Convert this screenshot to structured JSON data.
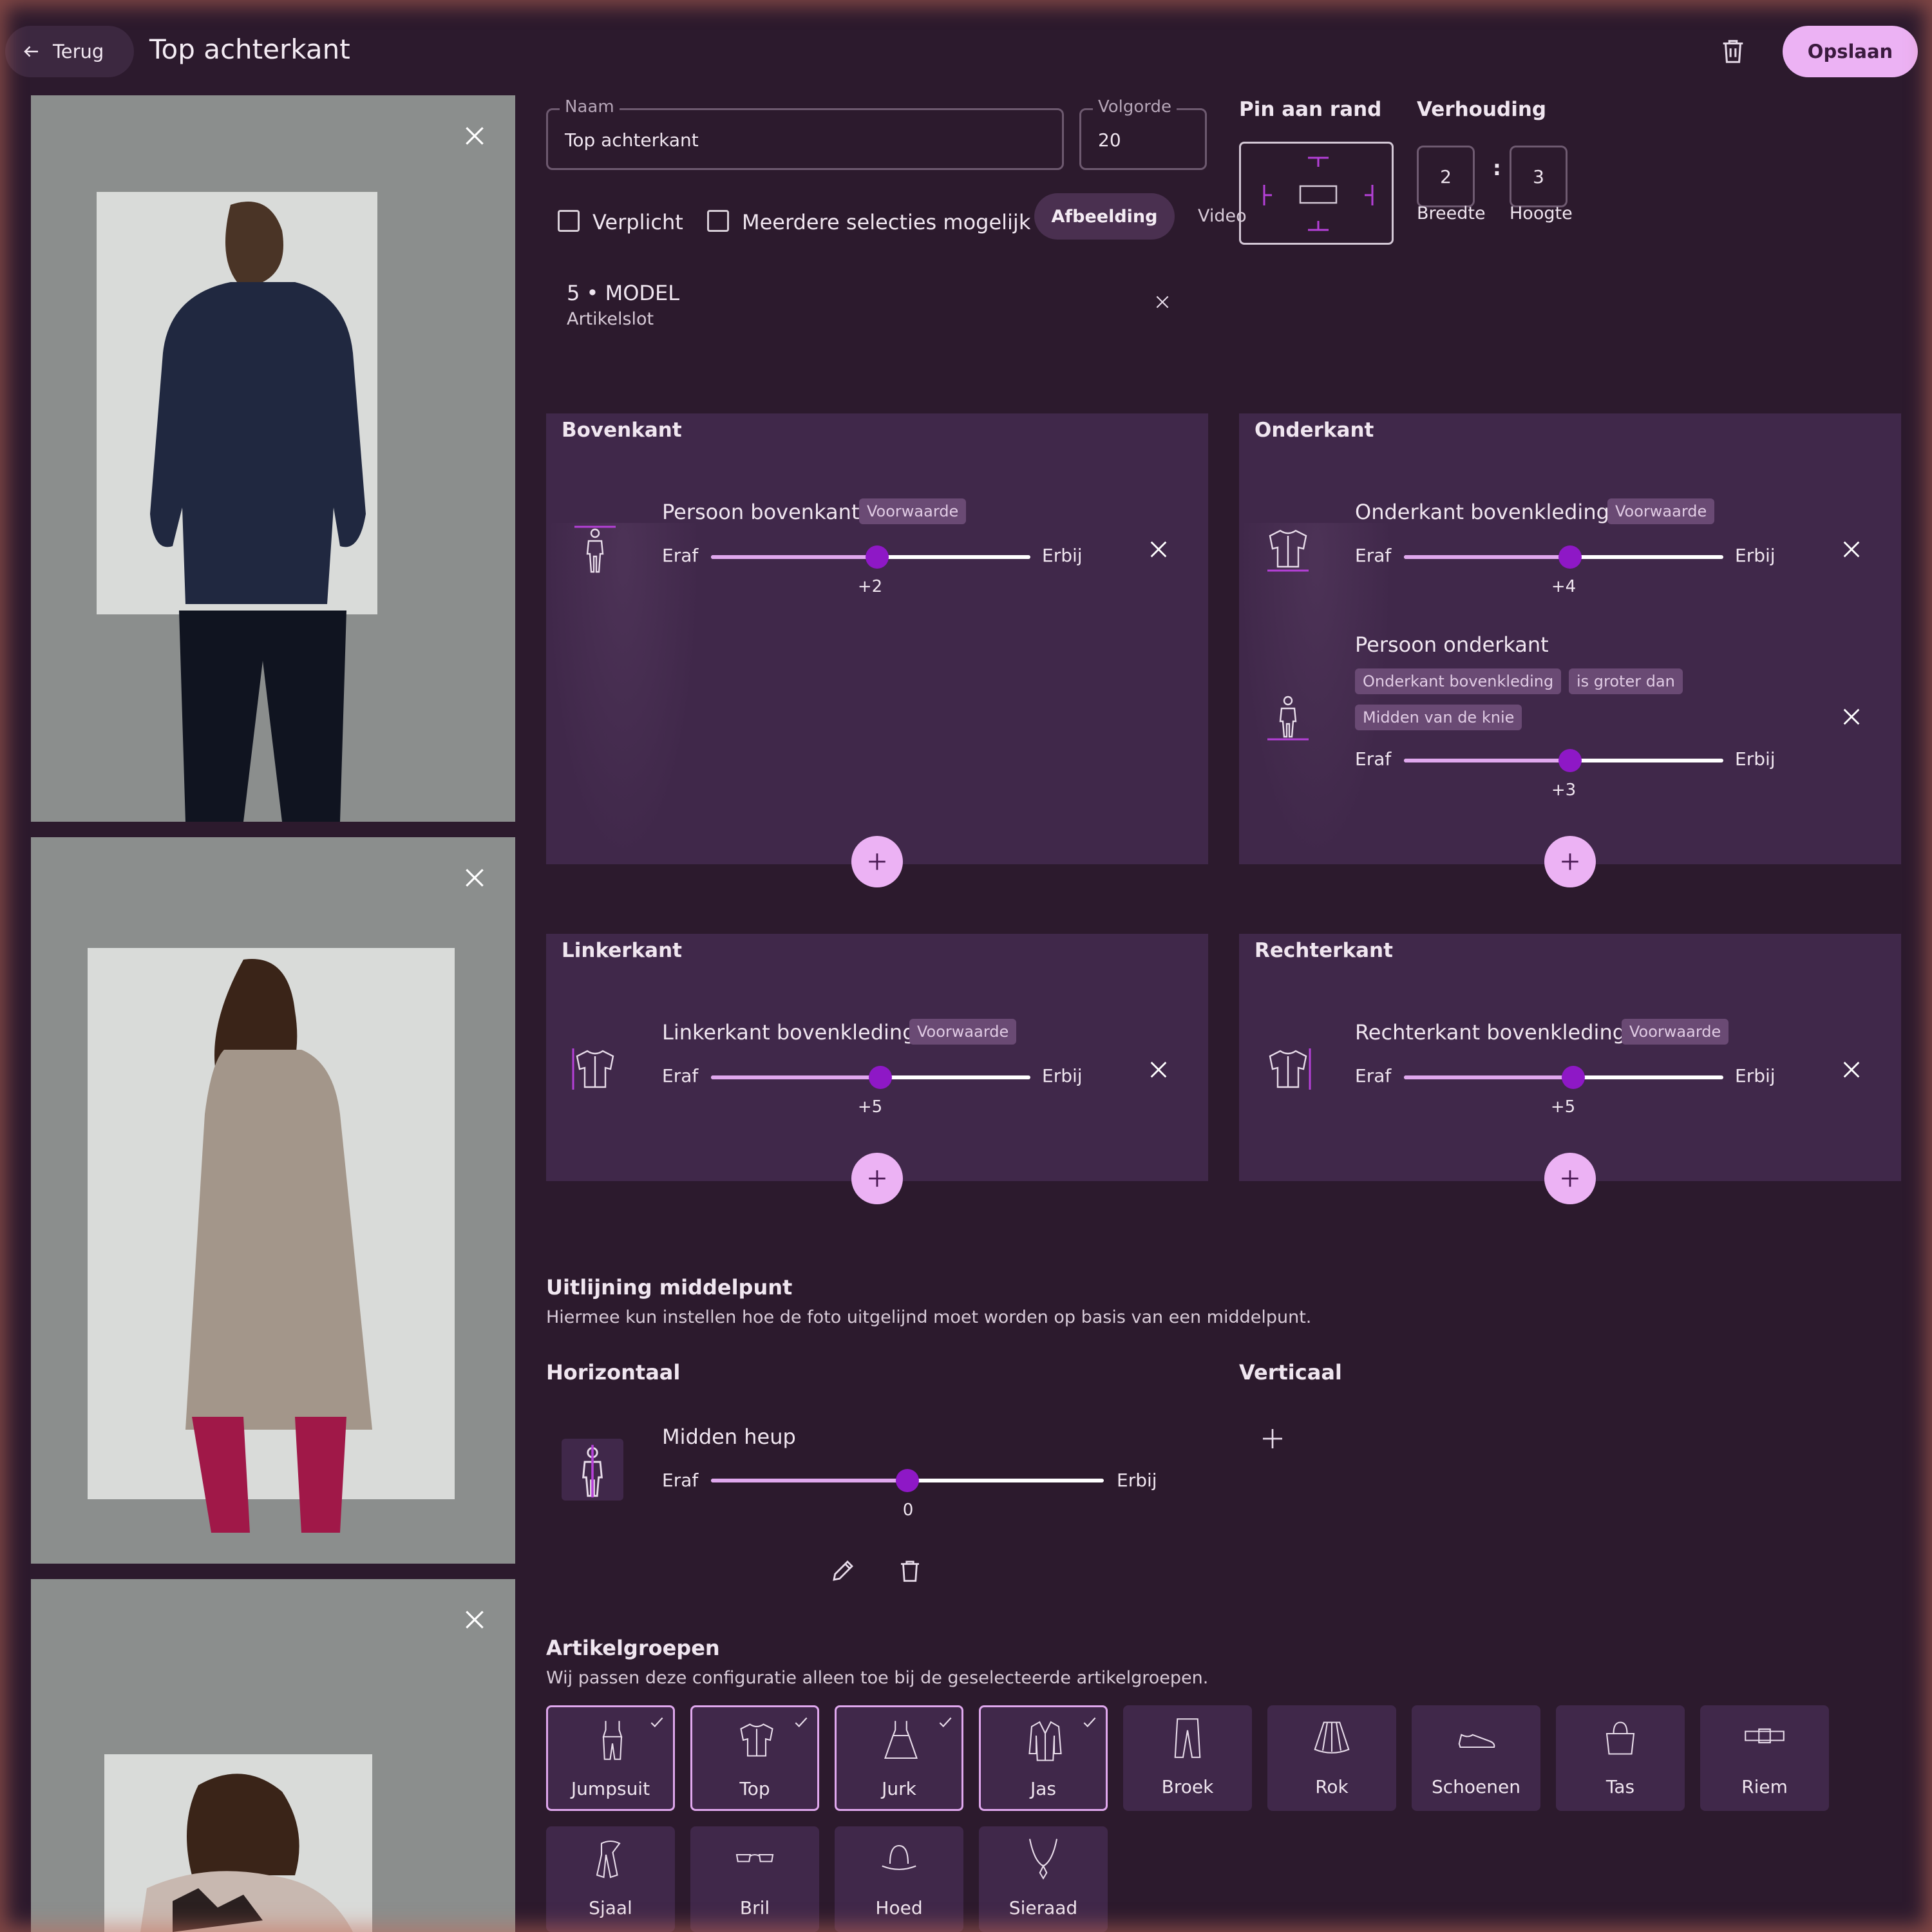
{
  "header": {
    "back_label": "Terug",
    "title": "Top achterkant",
    "save_label": "Opslaan"
  },
  "form": {
    "name_label": "Naam",
    "name_value": "Top achterkant",
    "order_label": "Volgorde",
    "order_value": "20",
    "pin_label": "Pin aan rand",
    "ratio_label": "Verhouding",
    "ratio_width": "2",
    "ratio_height": "3",
    "ratio_sep": ":",
    "ratio_width_label": "Breedte",
    "ratio_height_label": "Hoogte",
    "required_label": "Verplicht",
    "multi_label": "Meerdere selecties mogelijk",
    "tab_image": "Afbeelding",
    "tab_video": "Video",
    "slot_title": "5 • MODEL",
    "slot_sub": "Artikelslot"
  },
  "panels": {
    "top": {
      "title": "Bovenkant",
      "rules": [
        {
          "name": "Persoon bovenkant",
          "badge": "Voorwaarde",
          "left": "Eraf",
          "right": "Erbij",
          "value": "+2",
          "pos": 0.52
        }
      ]
    },
    "bottom": {
      "title": "Onderkant",
      "rules": [
        {
          "name": "Onderkant bovenkleding",
          "badge": "Voorwaarde",
          "left": "Eraf",
          "right": "Erbij",
          "value": "+4",
          "pos": 0.52
        },
        {
          "name": "Persoon onderkant",
          "badge1": "Onderkant bovenkleding",
          "badge2": "is groter dan",
          "badge3": "Midden van de knie",
          "left": "Eraf",
          "right": "Erbij",
          "value": "+3",
          "pos": 0.52
        }
      ]
    },
    "left": {
      "title": "Linkerkant",
      "rules": [
        {
          "name": "Linkerkant bovenkleding",
          "badge": "Voorwaarde",
          "left": "Eraf",
          "right": "Erbij",
          "value": "+5",
          "pos": 0.53
        }
      ]
    },
    "right": {
      "title": "Rechterkant",
      "rules": [
        {
          "name": "Rechterkant bovenkleding",
          "badge": "Voorwaarde",
          "left": "Eraf",
          "right": "Erbij",
          "value": "+5",
          "pos": 0.53
        }
      ]
    }
  },
  "alignment": {
    "title": "Uitlijning middelpunt",
    "description": "Hiermee kun instellen hoe de foto uitgelijnd moet worden op basis van een middelpunt.",
    "horizontal_label": "Horizontaal",
    "vertical_label": "Verticaal",
    "rule_name": "Midden heup",
    "left": "Eraf",
    "right": "Erbij",
    "value": "0",
    "pos": 0.5
  },
  "categories": {
    "title": "Artikelgroepen",
    "description": "Wij passen deze configuratie alleen toe bij de geselecteerde artikelgroepen.",
    "items": [
      {
        "label": "Jumpsuit",
        "icon": "jumpsuit-icon",
        "selected": true
      },
      {
        "label": "Top",
        "icon": "shirt-icon",
        "selected": true
      },
      {
        "label": "Jurk",
        "icon": "dress-icon",
        "selected": true
      },
      {
        "label": "Jas",
        "icon": "coat-icon",
        "selected": true
      },
      {
        "label": "Broek",
        "icon": "pants-icon",
        "selected": false
      },
      {
        "label": "Rok",
        "icon": "skirt-icon",
        "selected": false
      },
      {
        "label": "Schoenen",
        "icon": "shoe-icon",
        "selected": false
      },
      {
        "label": "Tas",
        "icon": "bag-icon",
        "selected": false
      },
      {
        "label": "Riem",
        "icon": "belt-icon",
        "selected": false
      },
      {
        "label": "Sjaal",
        "icon": "scarf-icon",
        "selected": false
      },
      {
        "label": "Bril",
        "icon": "glasses-icon",
        "selected": false
      },
      {
        "label": "Hoed",
        "icon": "hat-icon",
        "selected": false
      },
      {
        "label": "Sieraad",
        "icon": "necklace-icon",
        "selected": false
      }
    ]
  },
  "colors": {
    "background": "#2c1a2d",
    "panel": "#40284a",
    "accent": "#ecb2f4",
    "slider_thumb": "#8e18c6"
  }
}
